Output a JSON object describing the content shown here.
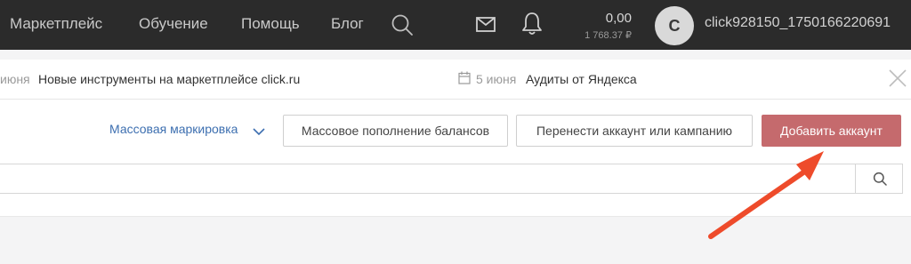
{
  "nav": {
    "links": [
      "Маркетплейс",
      "Обучение",
      "Помощь",
      "Блог"
    ],
    "icons": [
      "search-icon",
      "mail-icon",
      "bell-icon"
    ]
  },
  "balance": {
    "amount": "0,00",
    "secondary": "1 768.37 ₽"
  },
  "user": {
    "avatar_letter": "C",
    "name": "click928150_1750166220691"
  },
  "news": [
    {
      "date": "июня",
      "title": "Новые инструменты на маркетплейсе click.ru"
    },
    {
      "date": "5 июня",
      "title": "Аудиты от Яндекса"
    }
  ],
  "toolbar": {
    "mass_marking": "Массовая маркировка",
    "mass_topup": "Массовое пополнение балансов",
    "transfer": "Перенести аккаунт или кампанию",
    "add_account": "Добавить аккаунт"
  },
  "search": {
    "placeholder": "",
    "icon": "search-icon"
  },
  "colors": {
    "topbar": "#2b2b2b",
    "primary_button": "#c56a6d",
    "link": "#3d6fb0",
    "annotation_arrow": "#ee4b2b"
  }
}
